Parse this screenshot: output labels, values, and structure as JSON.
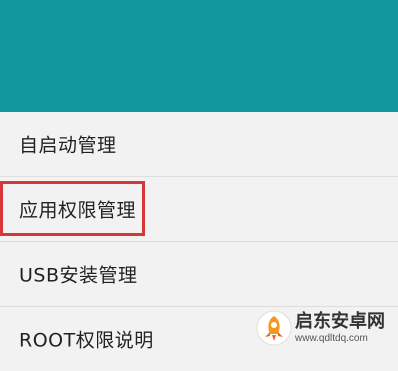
{
  "header": {
    "background_color": "#12979e"
  },
  "menu": {
    "items": [
      {
        "label": "自启动管理"
      },
      {
        "label": "应用权限管理",
        "highlighted": true
      },
      {
        "label": "USB安装管理"
      },
      {
        "label": "ROOT权限说明"
      }
    ]
  },
  "highlight": {
    "color": "#d9363a"
  },
  "watermark": {
    "title": "启东安卓网",
    "url": "www.qdltdq.com",
    "icon": "rocket-logo-icon"
  }
}
